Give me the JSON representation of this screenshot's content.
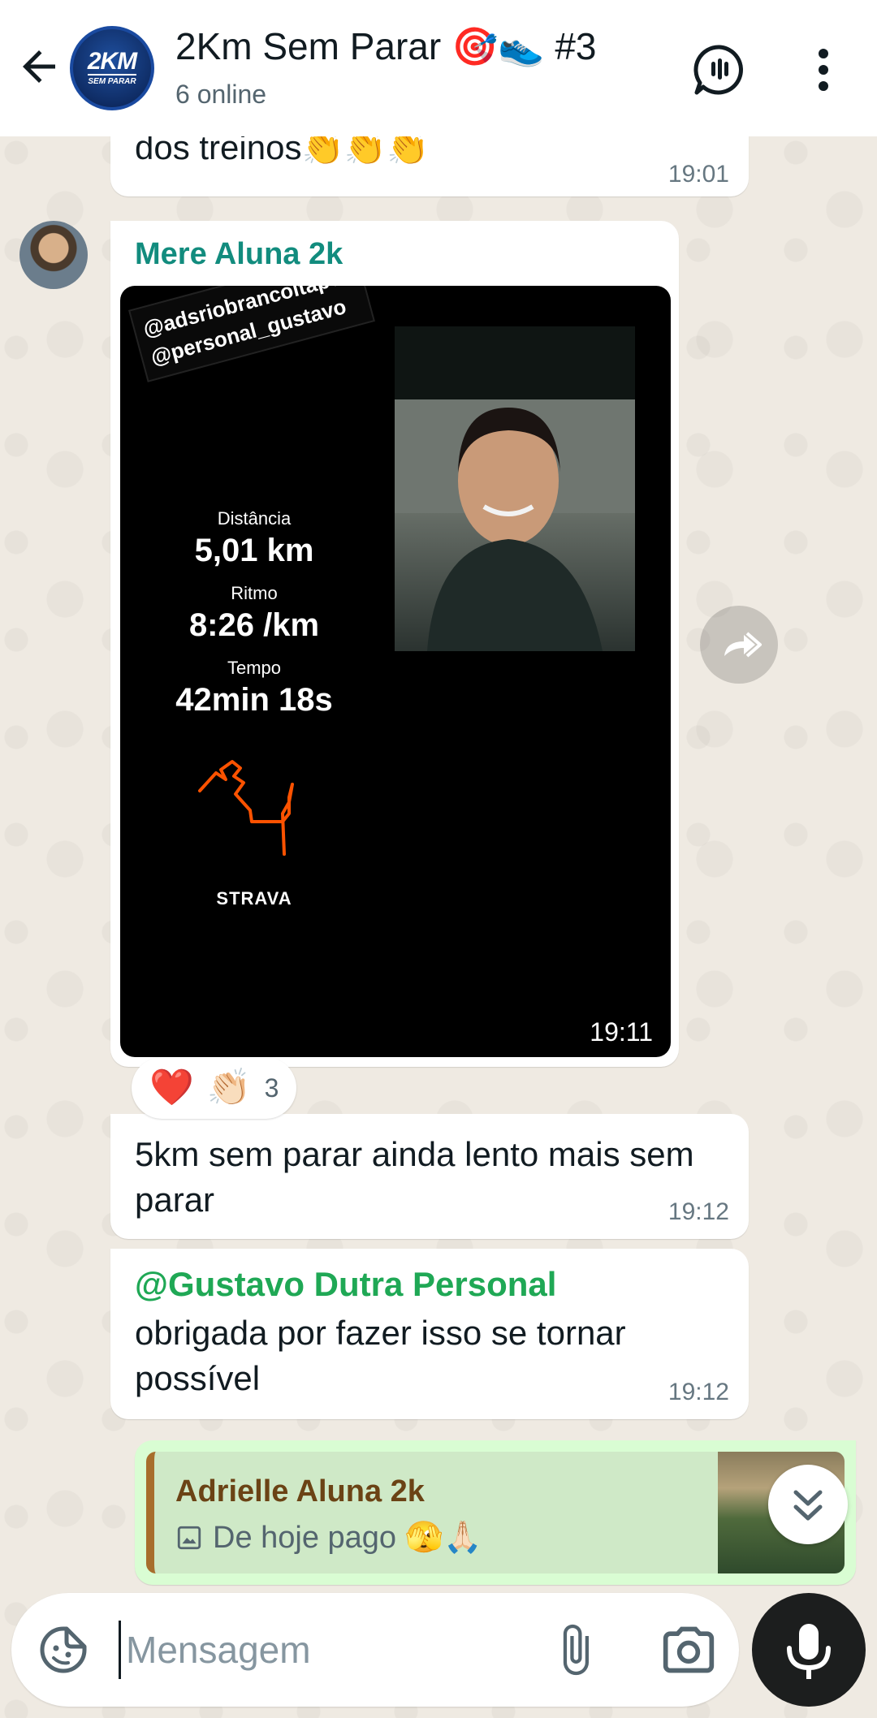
{
  "header": {
    "title": "2Km Sem Parar 🎯👟 #3",
    "subtitle": "6 online",
    "avatar_text_big": "2KM",
    "avatar_text_small": "SEM PARAR"
  },
  "messages": {
    "m1": {
      "text": "dos treinos👏👏👏",
      "time": "19:01"
    },
    "m2": {
      "sender": "Mere Aluna 2k",
      "time": "19:11",
      "image": {
        "tag_line1": "@adsriobrancoitape",
        "tag_line2": "@personal_gustavo",
        "distance_label": "Distância",
        "distance_value": "5,01 km",
        "pace_label": "Ritmo",
        "pace_value": "8:26 /km",
        "time_label": "Tempo",
        "time_value": "42min 18s",
        "brand": "STRAVA"
      }
    },
    "reactions": {
      "emoji1": "❤️",
      "emoji2": "👏🏻",
      "count": "3"
    },
    "m3": {
      "text": "5km sem parar ainda lento mais sem parar",
      "time": "19:12"
    },
    "m4": {
      "mention": "@Gustavo Dutra Personal",
      "text": "obrigada por fazer isso se tornar possível",
      "time": "19:12"
    },
    "m5": {
      "quote_name": "Adrielle Aluna 2k",
      "quote_text": "De hoje pago 🫣🙏🏻"
    }
  },
  "input": {
    "placeholder": "Mensagem"
  },
  "colors": {
    "accent": "#128c7e",
    "mention": "#1fa855",
    "outgoing_bubble": "#d9fdd3",
    "quote_bar": "#a76e2c"
  },
  "icons": [
    "back-arrow-icon",
    "voice-chat-icon",
    "more-vert-icon",
    "forward-icon",
    "chevron-double-down-icon",
    "sticker-icon",
    "attach-icon",
    "camera-icon",
    "mic-icon",
    "image-icon"
  ]
}
